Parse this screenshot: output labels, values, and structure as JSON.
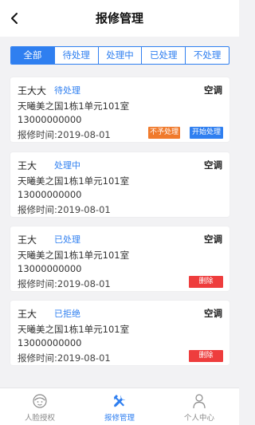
{
  "header": {
    "back_icon": "chevron-left-icon",
    "title": "报修管理"
  },
  "tabs": [
    {
      "label": "全部",
      "active": true
    },
    {
      "label": "待处理",
      "active": false
    },
    {
      "label": "处理中",
      "active": false
    },
    {
      "label": "已处理",
      "active": false
    },
    {
      "label": "不处理",
      "active": false
    }
  ],
  "orders": [
    {
      "name": "王大大",
      "status": "待处理",
      "type": "空调",
      "address": "天曦美之国1栋1单元101室",
      "phone": "13000000000",
      "date": "报修时间:2019-08-01",
      "actions": [
        "不予处理",
        "开始处理"
      ]
    },
    {
      "name": "王大",
      "status": "处理中",
      "type": "空调",
      "address": "天曦美之国1栋1单元101室",
      "phone": "13000000000",
      "date": "报修时间:2019-08-01",
      "actions": []
    },
    {
      "name": "王大",
      "status": "已处理",
      "type": "空调",
      "address": "天曦美之国1栋1单元101室",
      "phone": "13000000000",
      "date": "报修时间:2019-08-01",
      "actions": [
        "删除"
      ]
    },
    {
      "name": "王大",
      "status": "已拒绝",
      "type": "空调",
      "address": "天曦美之国1栋1单元101室",
      "phone": "13000000000",
      "date": "报修时间:2019-08-01",
      "actions": [
        "删除"
      ]
    }
  ],
  "bottom_nav": [
    {
      "label": "人脸授权",
      "icon": "face-icon",
      "active": false
    },
    {
      "label": "报修管理",
      "icon": "tools-icon",
      "active": true
    },
    {
      "label": "个人中心",
      "icon": "person-icon",
      "active": false
    }
  ],
  "colors": {
    "accent": "#2f7ff0",
    "reject": "#f07a2c",
    "delete": "#ee3d3d",
    "background": "#f2f2f4"
  }
}
